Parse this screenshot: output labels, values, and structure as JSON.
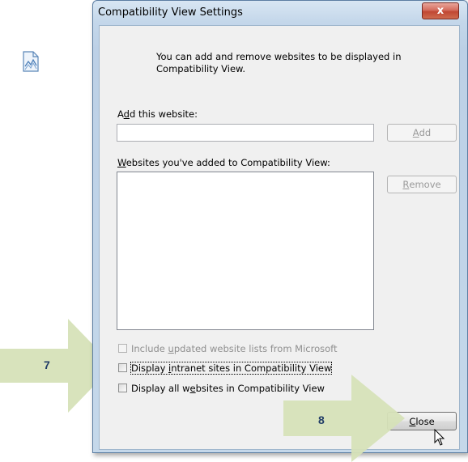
{
  "dialog": {
    "title": "Compatibility View Settings",
    "close_glyph": "x",
    "info_text": "You can add and remove websites to be displayed in Compatibility View.",
    "add_label_prefix": "A",
    "add_label_mnemonic": "d",
    "add_label_suffix": "d this website:",
    "add_input_value": "",
    "add_button": {
      "mnemonic": "A",
      "rest": "dd"
    },
    "list_label_mnemonic": "W",
    "list_label_rest": "ebsites you've added to Compatibility View:",
    "remove_button": {
      "mnemonic": "R",
      "rest": "emove"
    },
    "checkboxes": [
      {
        "prefix": "Include ",
        "mnemonic": "u",
        "suffix": "pdated website lists from Microsoft",
        "checked": false,
        "enabled": false
      },
      {
        "prefix": "Display ",
        "mnemonic": "i",
        "suffix": "ntranet sites in Compatibility View",
        "checked": false,
        "enabled": true
      },
      {
        "prefix": "Display all w",
        "mnemonic": "e",
        "suffix": "bsites in Compatibility View",
        "checked": false,
        "enabled": true
      }
    ],
    "close_button": {
      "mnemonic": "C",
      "rest": "lose"
    }
  },
  "callouts": {
    "step7": "7",
    "step8": "8",
    "color": "#d6e2b8"
  },
  "icons": {
    "info": "web-page-icon",
    "cursor": "mouse-pointer-icon"
  }
}
